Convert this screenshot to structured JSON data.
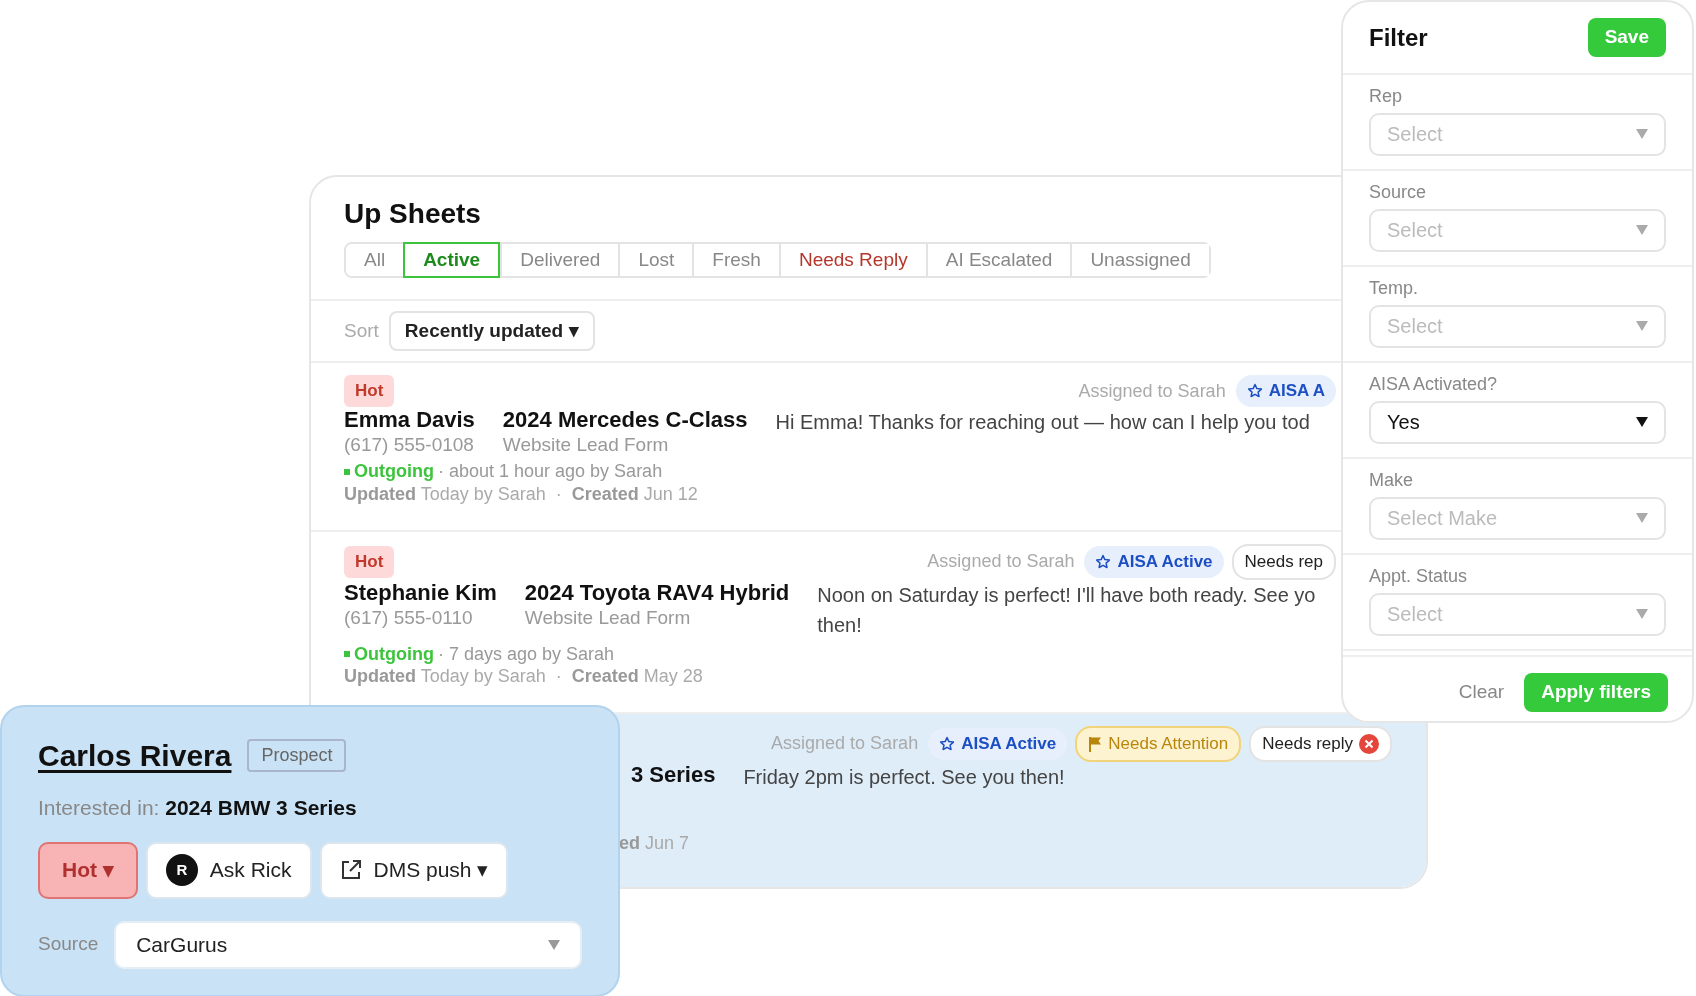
{
  "up_sheets": {
    "title": "Up Sheets",
    "tabs": [
      {
        "label": "All",
        "selected": false,
        "kind": "normal"
      },
      {
        "label": "Active",
        "selected": true,
        "kind": "normal"
      },
      {
        "label": "Delivered",
        "selected": false,
        "kind": "normal"
      },
      {
        "label": "Lost",
        "selected": false,
        "kind": "normal"
      },
      {
        "label": "Fresh",
        "selected": false,
        "kind": "normal"
      },
      {
        "label": "Needs Reply",
        "selected": false,
        "kind": "alert"
      },
      {
        "label": "AI Escalated",
        "selected": false,
        "kind": "normal"
      },
      {
        "label": "Unassigned",
        "selected": false,
        "kind": "normal"
      }
    ],
    "sort": {
      "label": "Sort",
      "value": "Recently updated ▾"
    },
    "leads": [
      {
        "selected": false,
        "temperature": "Hot",
        "name": "Emma Davis",
        "phone": "(617) 555-0108",
        "vehicle": "2024 Mercedes C-Class",
        "source": "Website Lead Form",
        "message": "Hi Emma! Thanks for reaching out — how can I help you tod",
        "tags": [
          {
            "kind": "assigned",
            "text": "Assigned to Sarah"
          },
          {
            "kind": "aisa",
            "text": "AISA A"
          }
        ],
        "activity": {
          "direction": "Outgoing",
          "detail": "· about 1 hour ago by Sarah"
        },
        "dates": "**Updated** Today by Sarah  ·  **Created** Jun 12"
      },
      {
        "selected": false,
        "temperature": "Hot",
        "name": "Stephanie Kim",
        "phone": "(617) 555-0110",
        "vehicle": "2024 Toyota RAV4 Hybrid",
        "source": "Website Lead Form",
        "message": "Noon on Saturday is perfect! I'll have both ready. See yo then!",
        "tags": [
          {
            "kind": "assigned",
            "text": "Assigned to Sarah"
          },
          {
            "kind": "aisa",
            "text": "AISA Active"
          },
          {
            "kind": "reply",
            "text": "Needs rep"
          }
        ],
        "activity": {
          "direction": "Outgoing",
          "detail": "· 7 days ago by Sarah"
        },
        "dates": "**Updated** Today by Sarah  ·  **Created** May 28"
      },
      {
        "selected": true,
        "vehicle": "3 Series",
        "message": "Friday 2pm is perfect. See you then!",
        "tags": [
          {
            "kind": "assigned",
            "text": "Assigned to Sarah"
          },
          {
            "kind": "aisa",
            "text": "AISA Active"
          },
          {
            "kind": "attention",
            "text": "Needs Attention"
          },
          {
            "kind": "reply",
            "text": "Needs reply"
          }
        ],
        "dates": "**ed** Jun 7"
      }
    ]
  },
  "filter": {
    "title": "Filter",
    "save": "Save",
    "fields": [
      {
        "label": "Rep",
        "placeholder": "Select"
      },
      {
        "label": "Source",
        "placeholder": "Select"
      },
      {
        "label": "Temp.",
        "placeholder": "Select"
      },
      {
        "label": "AISA Activated?",
        "value": "Yes"
      },
      {
        "label": "Make",
        "placeholder": "Select Make"
      },
      {
        "label": "Appt. Status",
        "placeholder": "Select"
      }
    ],
    "clear": "Clear",
    "apply": "Apply filters"
  },
  "lead_card": {
    "name": "Carlos Rivera",
    "status": "Prospect",
    "interest": "Interested in: **2024 BMW 3 Series**",
    "actions": [
      {
        "kind": "temperature",
        "label": "Hot ▾"
      },
      {
        "kind": "assistant",
        "avatar": "R",
        "label": "Ask Rick"
      },
      {
        "kind": "dms",
        "label": "DMS push ▾"
      }
    ],
    "source": {
      "label": "Source",
      "value": "CarGurus"
    }
  }
}
